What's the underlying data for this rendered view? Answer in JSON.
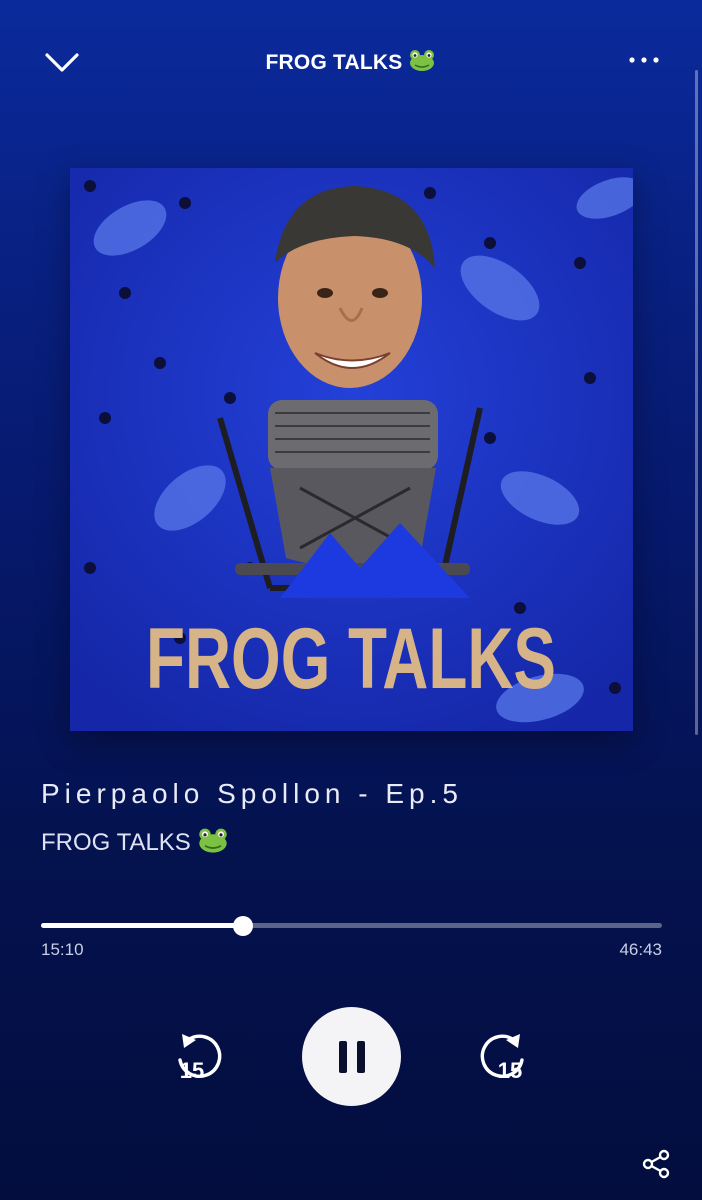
{
  "header": {
    "title": "FROG TALKS",
    "title_emoji": "frog-face-emoji",
    "down_icon": "chevron-down-icon",
    "more_icon": "more-options-icon"
  },
  "cover": {
    "alt": "FROG TALKS cover art",
    "text": "FROG TALKS",
    "colors": {
      "background": "#1a2fc7",
      "text": "#d6b487",
      "frog": "#4f6ee6"
    }
  },
  "episode": {
    "title": "Pierpaolo Spollon - Ep.5",
    "show": "FROG TALKS",
    "show_emoji": "frog-face-emoji"
  },
  "playback": {
    "elapsed": "15:10",
    "duration": "46:43",
    "progress_fraction": 0.3246,
    "skip_back_label": "15",
    "skip_forward_label": "15",
    "state": "playing"
  },
  "actions": {
    "share_icon": "share-icon"
  }
}
